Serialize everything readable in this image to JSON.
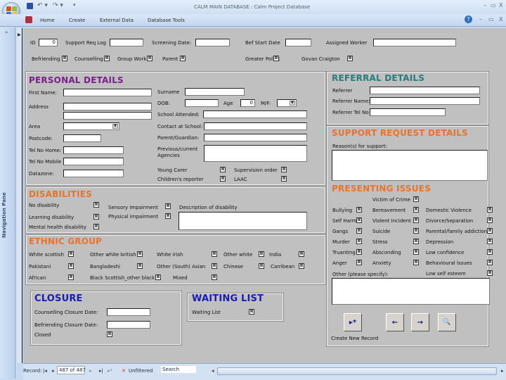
{
  "window": {
    "title": "CALM MAIN DATABASE : Calm Project Database",
    "minimize": "–",
    "restore": "▭",
    "close": "X"
  },
  "ribbon": {
    "tabs": [
      "Home",
      "Create",
      "External Data",
      "Database Tools"
    ],
    "help": "?"
  },
  "nav_pane": {
    "label": "Navigation Pane",
    "toggle": "»"
  },
  "header_fields": {
    "id_label": "ID",
    "id_value": "0",
    "support_req_label": "Support Req Log",
    "screening_label": "Screening Date:",
    "bef_start_label": "Bef Start Date",
    "assigned_worker_label": "Assigned Worker"
  },
  "services": [
    {
      "label": "Befriending",
      "checked": true
    },
    {
      "label": "Counselling",
      "checked": true
    },
    {
      "label": "Group Work",
      "checked": true
    },
    {
      "label": "Parent",
      "checked": true
    },
    {
      "label": "Greater Pollok",
      "checked": true
    },
    {
      "label": "Govan Craigton",
      "checked": true
    }
  ],
  "personal": {
    "title": "PERSONAL DETAILS",
    "first_name": "First Name:",
    "address": "Address",
    "area": "Area",
    "postcode": "Postcode:",
    "tel_home": "Tel No Home:",
    "tel_mobile": "Tel No Mobile",
    "datazone": "Datazone:",
    "surname": "Surname",
    "dob": "DOB:",
    "age_label": "Age",
    "age_value": "0",
    "mf_label": "M/F:",
    "school": "School Attended:",
    "contact_school": "Contact at School:",
    "parent": "Parent/Guardian:",
    "prev_agencies": "Previous/current Agencies",
    "young_carer": "Young Carer",
    "childrens_reporter": "Children's reporter",
    "supervision_order": "Supervision order",
    "laac": "LAAC"
  },
  "referral": {
    "title": "REFERRAL DETAILS",
    "referrer": "Referrer",
    "referrer_name": "Referrer Name:",
    "referrer_tel": "Referrer Tel No"
  },
  "support_request": {
    "title": "SUPPORT REQUEST DETAILS",
    "reasons": "Reason(s) for support:"
  },
  "disabilities": {
    "title": "DISABILITIES",
    "items": [
      "No disability",
      "Learning disability",
      "Mental health disability",
      "Sensory impairment",
      "Physical impairment"
    ],
    "description": "Description of disability"
  },
  "ethnic": {
    "title": "ETHNIC GROUP",
    "items": [
      "White scottish",
      "Pakistani",
      "African",
      "Other white british",
      "Bangladeshi",
      "Black Scottish_other black",
      "White irish",
      "Other (South) Asian",
      "Mixed",
      "Other white",
      "Chinese",
      "India",
      "Carribean"
    ]
  },
  "closure": {
    "title": "CLOSURE",
    "counselling_date": "Counselling Closure Date:",
    "befriending_date": "Befriending Closure Date:",
    "closed": "Closed"
  },
  "waiting": {
    "title": "WAITING LIST",
    "label": "Waiting List"
  },
  "presenting": {
    "title": "PRESENTING ISSUES",
    "col1": [
      "Bullying",
      "Self Harm",
      "Gangs",
      "Murder",
      "Truanting",
      "Anger"
    ],
    "col2": [
      "Victim of Crime",
      "Bereavement",
      "Violent Incident",
      "Suicide",
      "Stress",
      "Absconding",
      "Anxiety"
    ],
    "col3": [
      "Domestic Violence",
      "Divorce/Separation",
      "Parental/family addiction",
      "Depression",
      "Low confidence",
      "Behavioural issues",
      "Low self esteem"
    ],
    "other": "Other (please specify):"
  },
  "nav_buttons": {
    "new": "▸*",
    "prev": "←",
    "next": "→",
    "find": "🔍",
    "create_label": "Create New Record"
  },
  "status": {
    "record_label": "Record:",
    "first": "|◂",
    "prev": "◂",
    "position": "487 of 487",
    "next": "▸",
    "last": "▸|",
    "new": "▸*",
    "filter": "Unfiltered",
    "search": "Search"
  },
  "colors": {
    "personal": "#7b1f8c",
    "referral": "#2a7b7d",
    "orange": "#e8732c",
    "blue": "#1a1ab8"
  }
}
